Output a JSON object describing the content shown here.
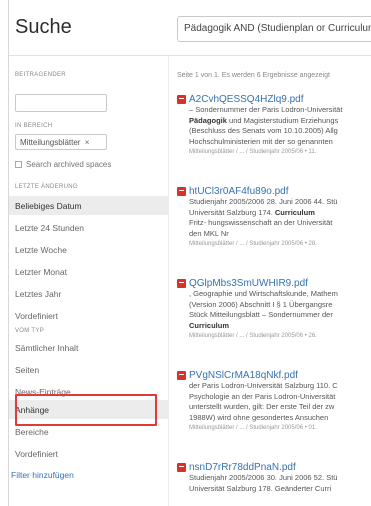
{
  "header": {
    "title": "Suche",
    "query": "Pädagogik AND (Studienplan or Curriculum)"
  },
  "sidebar": {
    "contributor_label": "BEITRAGENDER",
    "space_label": "IN BEREICH",
    "space_value": "Mitteilungsblätter",
    "space_remove": "×",
    "archived_label": "Search archived spaces",
    "modified_label": "LETZTE ÄNDERUNG",
    "modified_items": [
      "Beliebiges Datum",
      "Letzte 24 Stunden",
      "Letzte Woche",
      "Letzter Monat",
      "Letztes Jahr",
      "Vordefiniert"
    ],
    "type_label": "VOM TYP",
    "type_items": [
      "Sämtlicher Inhalt",
      "Seiten",
      "News-Einträge",
      "Anhänge",
      "Bereiche",
      "Vordefiniert"
    ],
    "add_filter": "Filter hinzufügen"
  },
  "results": {
    "summary": "Seite 1 von 1. Es werden 6 Ergebnisse angezeigt",
    "items": [
      {
        "title": "A2CvhQESSQ4HZlq9.pdf",
        "lines": [
          [
            "",
            "– Sondernummer der Paris Lodron-Universität"
          ],
          [
            "Pädagogik",
            " und Magisterstudium Erziehungs"
          ],
          [
            "",
            "(Beschluss des Senats vom 10.10.2005) Allg"
          ],
          [
            "",
            "Hochschulministerien mit der so genannten"
          ]
        ],
        "path": "Mitteilungsblätter / ... / Studienjahr 2005/06 • 11."
      },
      {
        "title": "htUCl3r0AF4fu89o.pdf",
        "lines": [
          [
            "",
            "Studienjahr 2005/2006 28. Juni 2006 44. Stü"
          ],
          [
            "",
            "Universität Salzburg 174. "
          ],
          [
            "",
            "Fritz- hungswissenschaft an der Universität"
          ],
          [
            "",
            "den MKL Nr"
          ]
        ],
        "boldword": "Curriculum",
        "path": "Mitteilungsblätter / ... / Studienjahr 2005/06 • 28."
      },
      {
        "title": "QGlpMbs3SmUWHIR9.pdf",
        "lines": [
          [
            "",
            ", Geographie und Wirtschaftskunde, Mathem"
          ],
          [
            "",
            "(Version 2006) Abschnitt I § 1 Übergangsre"
          ],
          [
            "",
            "Stück Mitteilungsblatt – Sondernummer der"
          ],
          [
            "Curriculum",
            ""
          ]
        ],
        "path": "Mitteilungsblätter / ... / Studienjahr 2005/06 • 26."
      },
      {
        "title": "PVgNSlCrMA18qNkf.pdf",
        "lines": [
          [
            "",
            "der Paris Lodron-Universität Salzburg 110. C"
          ],
          [
            "",
            "Psychologie an der Paris Lodron-Universität"
          ],
          [
            "",
            "unterstellt wurden, gilt: Der erste Teil der zw"
          ],
          [
            "",
            "1988W) wird ohne gesondertes Ansuchen"
          ]
        ],
        "path": "Mitteilungsblätter / ... / Studienjahr 2005/06 • 01."
      },
      {
        "title": "nsnD7rRr78ddPnaN.pdf",
        "lines": [
          [
            "",
            "Studienjahr 2005/2006 30. Juni 2006 52. Stü"
          ],
          [
            "",
            "Universität Salzburg 178. Geänderter Curri"
          ]
        ],
        "path": ""
      }
    ]
  }
}
